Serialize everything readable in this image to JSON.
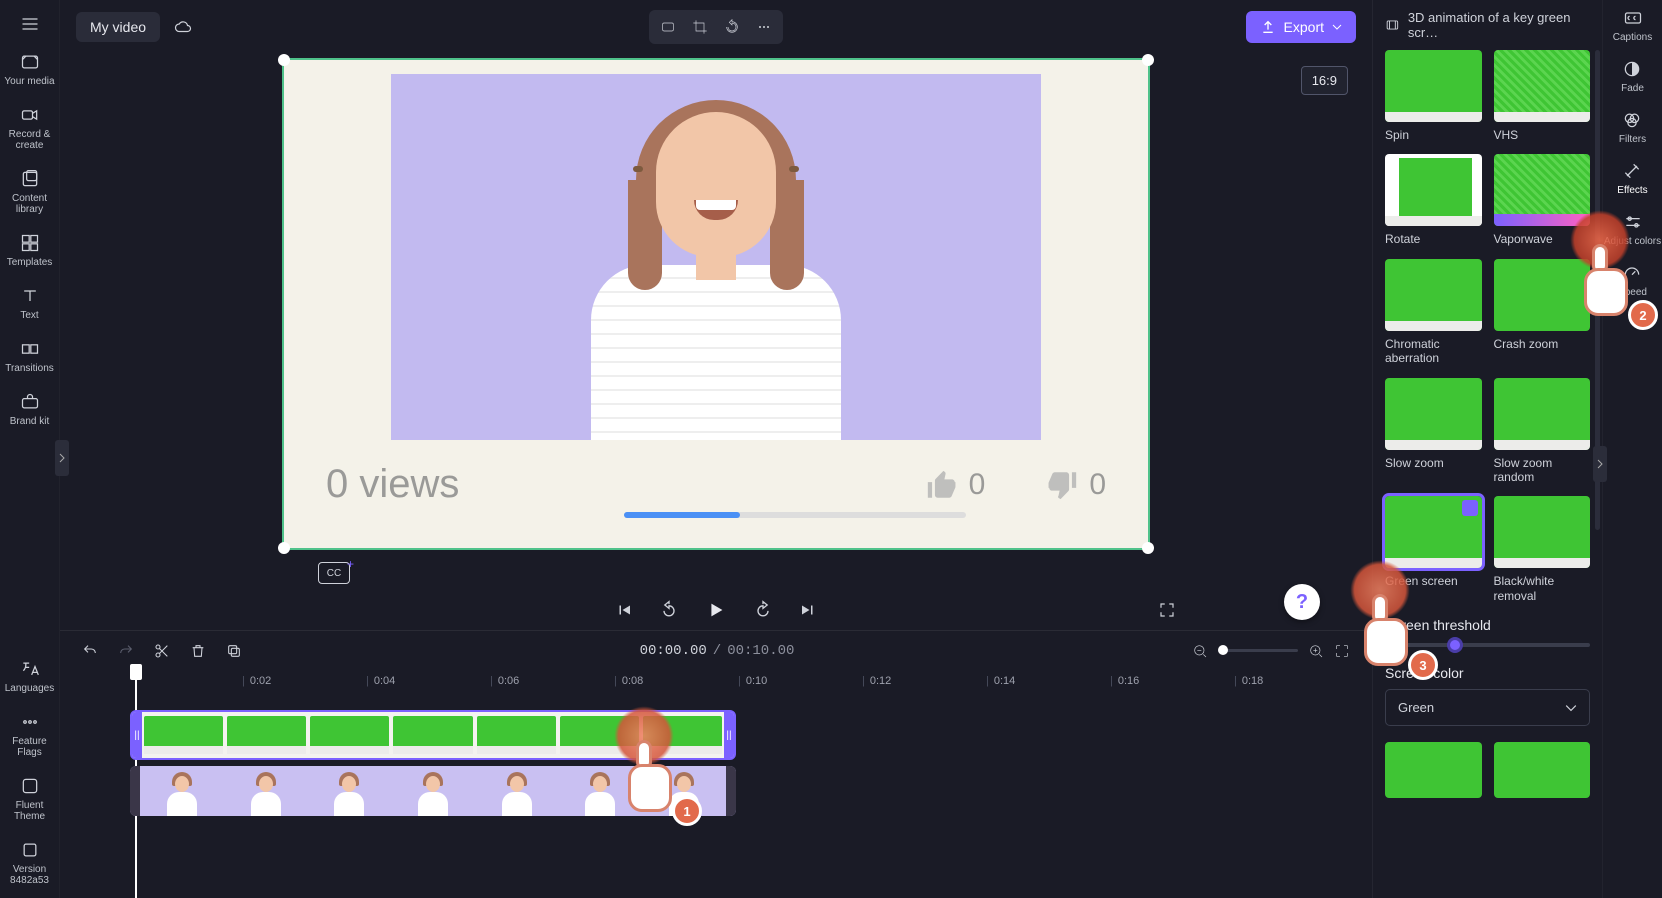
{
  "header": {
    "title": "My video",
    "export_label": "Export",
    "panel_title": "3D animation of a key green scr…",
    "aspect_ratio": "16:9"
  },
  "left_rail": {
    "items": [
      {
        "label": "Your media"
      },
      {
        "label": "Record & create"
      },
      {
        "label": "Content library"
      },
      {
        "label": "Templates"
      },
      {
        "label": "Text"
      },
      {
        "label": "Transitions"
      },
      {
        "label": "Brand kit"
      }
    ],
    "bottom_items": [
      {
        "label": "Languages"
      },
      {
        "label": "Feature Flags"
      },
      {
        "label": "Fluent Theme"
      },
      {
        "label": "Version 8482a53"
      }
    ]
  },
  "preview": {
    "views_text": "0 views",
    "like_count": "0",
    "dislike_count": "0"
  },
  "transport": {
    "current_time": "00:00.00",
    "total_time": "00:10.00",
    "separator": "/"
  },
  "ruler": {
    "ticks": [
      "0:02",
      "0:04",
      "0:06",
      "0:08",
      "0:10",
      "0:12",
      "0:14",
      "0:16",
      "0:18"
    ]
  },
  "effects": {
    "items": [
      {
        "label": "Spin"
      },
      {
        "label": "VHS"
      },
      {
        "label": "Rotate"
      },
      {
        "label": "Vaporwave"
      },
      {
        "label": "Chromatic aberration"
      },
      {
        "label": "Crash zoom"
      },
      {
        "label": "Slow zoom"
      },
      {
        "label": "Slow zoom random"
      },
      {
        "label": "Green screen"
      },
      {
        "label": "Black/white removal"
      }
    ],
    "threshold_label": "Screen threshold",
    "color_label": "Screen color",
    "color_value": "Green"
  },
  "right_rail": {
    "items": [
      {
        "label": "Captions"
      },
      {
        "label": "Fade"
      },
      {
        "label": "Filters"
      },
      {
        "label": "Effects"
      },
      {
        "label": "Adjust colors"
      },
      {
        "label": "Speed"
      }
    ]
  },
  "annotations": {
    "n1": "1",
    "n2": "2",
    "n3": "3"
  },
  "cc": "CC"
}
